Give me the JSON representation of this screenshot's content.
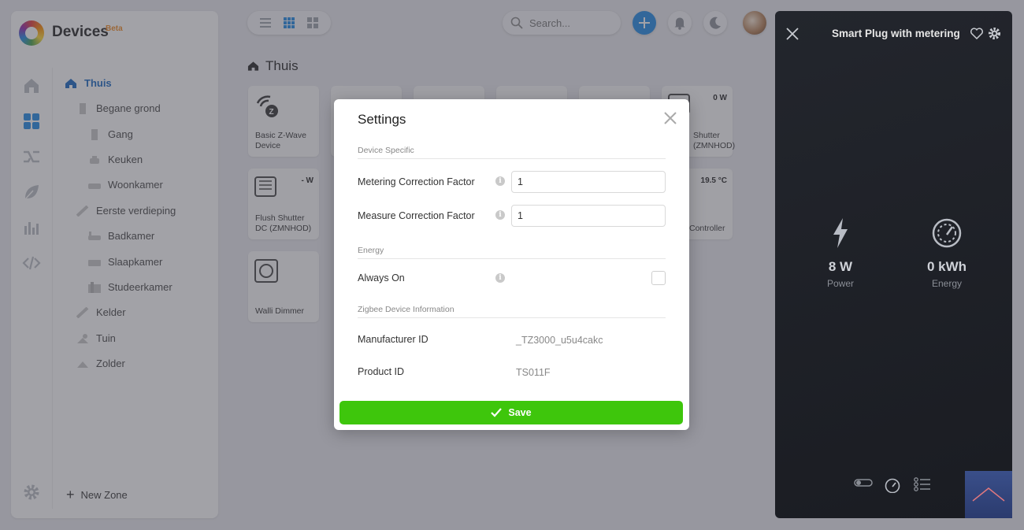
{
  "app": {
    "title": "Devices",
    "badge": "Beta"
  },
  "rail": [
    "home-icon",
    "devices-grid-icon",
    "flows-icon",
    "energy-leaf-icon",
    "insights-icon",
    "developer-code-icon",
    "settings-gear-icon"
  ],
  "tree": {
    "items": [
      {
        "label": "Thuis",
        "level": 0,
        "icon": "home-icon",
        "active": true
      },
      {
        "label": "Begane grond",
        "level": 1,
        "icon": "floor-icon"
      },
      {
        "label": "Gang",
        "level": 2,
        "icon": "hallway-icon"
      },
      {
        "label": "Keuken",
        "level": 2,
        "icon": "kitchen-icon"
      },
      {
        "label": "Woonkamer",
        "level": 2,
        "icon": "sofa-icon"
      },
      {
        "label": "Eerste verdieping",
        "level": 1,
        "icon": "stairs-icon"
      },
      {
        "label": "Badkamer",
        "level": 2,
        "icon": "bath-icon"
      },
      {
        "label": "Slaapkamer",
        "level": 2,
        "icon": "bed-icon"
      },
      {
        "label": "Studeerkamer",
        "level": 2,
        "icon": "study-icon"
      },
      {
        "label": "Kelder",
        "level": 1,
        "icon": "stairs-icon"
      },
      {
        "label": "Tuin",
        "level": 1,
        "icon": "garden-icon"
      },
      {
        "label": "Zolder",
        "level": 1,
        "icon": "attic-icon"
      }
    ],
    "new_zone": "New Zone"
  },
  "topbar": {
    "search_placeholder": "Search..."
  },
  "zone": {
    "title": "Thuis"
  },
  "tiles": [
    {
      "name": "Basic Z-Wave Device",
      "value": ""
    },
    {
      "name": "",
      "value": ""
    },
    {
      "name": "",
      "value": ""
    },
    {
      "name": "",
      "value": ""
    },
    {
      "name": "",
      "value": ""
    },
    {
      "name": "Shutter (ZMNHOD)",
      "value": "0 W"
    },
    {
      "name": "Flush Shutter DC (ZMNHOD)",
      "value": "- W"
    },
    {
      "name": "Controller",
      "value": "19.5 °C"
    },
    {
      "name": "Walli Dimmer",
      "value": ""
    }
  ],
  "modal": {
    "title": "Settings",
    "sections": {
      "device_specific": "Device Specific",
      "energy": "Energy",
      "zigbee": "Zigbee Device Information"
    },
    "fields": {
      "metering_label": "Metering Correction Factor",
      "metering_value": "1",
      "measure_label": "Measure Correction Factor",
      "measure_value": "1",
      "always_on_label": "Always On",
      "always_on_checked": false,
      "manufacturer_label": "Manufacturer ID",
      "manufacturer_value": "_TZ3000_u5u4cakc",
      "product_label": "Product ID",
      "product_value": "TS011F"
    },
    "save_label": "Save",
    "colors": {
      "save": "#3ec60c"
    }
  },
  "device_panel": {
    "title": "Smart Plug with metering",
    "metrics": [
      {
        "value": "8 W",
        "label": "Power",
        "icon": "lightning-icon"
      },
      {
        "value": "0 kWh",
        "label": "Energy",
        "icon": "gauge-icon"
      }
    ],
    "bottom_icons": [
      "toggle-icon",
      "gauge-icon",
      "settings-list-icon"
    ]
  }
}
